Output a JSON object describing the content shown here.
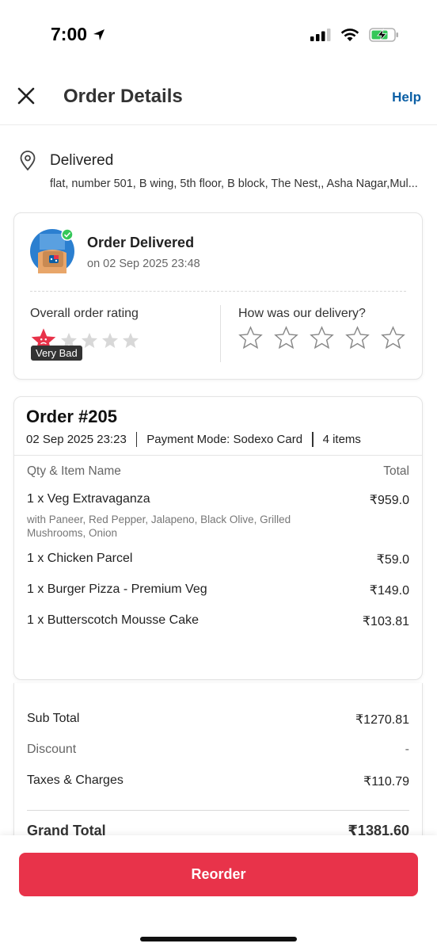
{
  "status_bar": {
    "time": "7:00"
  },
  "header": {
    "title": "Order Details",
    "help_label": "Help"
  },
  "address": {
    "status": "Delivered",
    "line": "flat, number 501, B wing, 5th floor, B block, The Nest,, Asha Nagar,Mul..."
  },
  "delivery_card": {
    "title": "Order Delivered",
    "date": "on 02 Sep 2025 23:48",
    "overall_rating_label": "Overall order rating",
    "overall_rating_value": 1,
    "overall_rating_max": 5,
    "rating_badge": "Very Bad",
    "delivery_question": "How was our delivery?"
  },
  "order": {
    "number": "Order #205",
    "datetime": "02 Sep 2025 23:23",
    "payment": "Payment Mode: Sodexo Card",
    "items_count": "4 items",
    "col_item": "Qty & Item Name",
    "col_total": "Total",
    "items": [
      {
        "name": "1 x Veg Extravaganza",
        "price": "₹959.0",
        "desc": "with Paneer, Red Pepper, Jalapeno, Black Olive, Grilled Mushrooms, Onion"
      },
      {
        "name": "1 x Chicken Parcel",
        "price": "₹59.0"
      },
      {
        "name": "1 x Burger Pizza - Premium Veg",
        "price": "₹149.0"
      },
      {
        "name": "1 x Butterscotch Mousse Cake",
        "price": "₹103.81"
      }
    ]
  },
  "totals": {
    "sub_total_label": "Sub Total",
    "sub_total": "₹1270.81",
    "discount_label": "Discount",
    "discount": "-",
    "taxes_label": "Taxes & Charges",
    "taxes": "₹110.79",
    "grand_label": "Grand Total",
    "grand": "₹1381.60"
  },
  "bottom": {
    "reorder_label": "Reorder"
  },
  "colors": {
    "accent": "#e8334a",
    "link": "#0b5fa5",
    "star_filled": "#e8334a"
  }
}
